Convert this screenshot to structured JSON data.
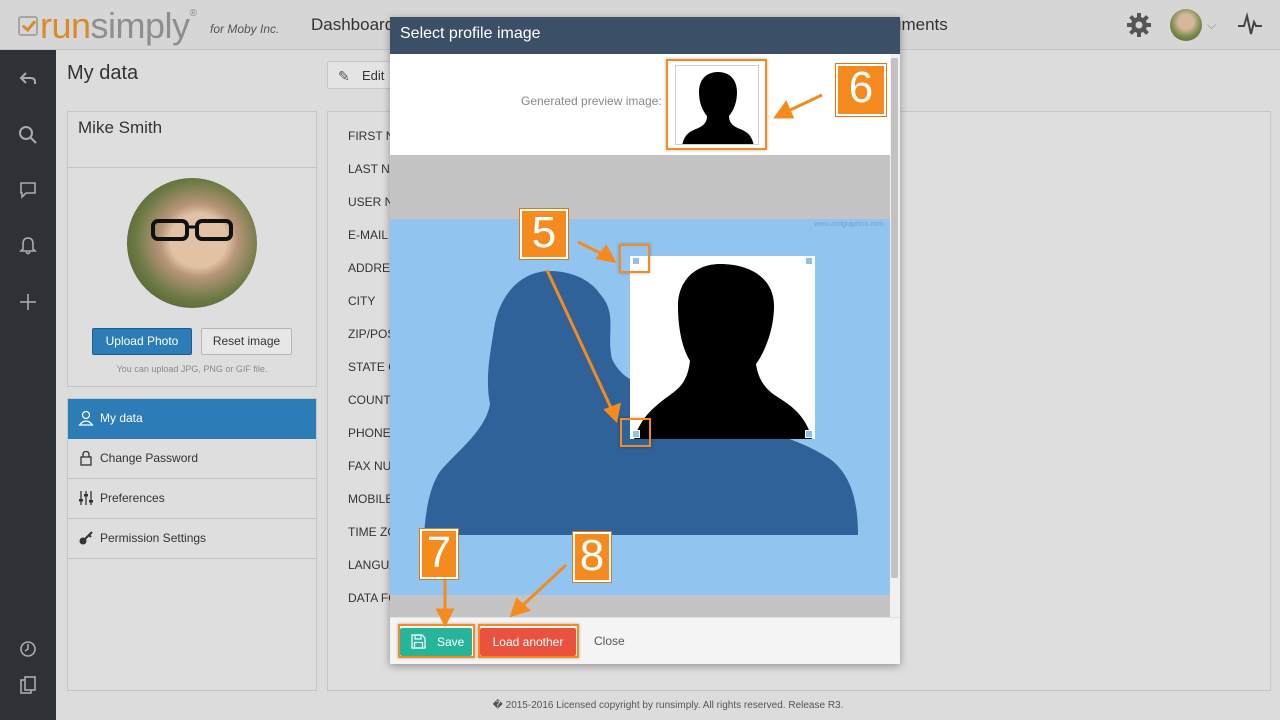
{
  "app": {
    "logo_run": "run",
    "logo_simply": "simply",
    "logo_reg": "®",
    "company": "for Moby Inc.",
    "nav_dashboard": "Dashboard",
    "nav_documents": "uments"
  },
  "page": {
    "title": "My data",
    "edit_label": "Edit"
  },
  "profile": {
    "name": "Mike Smith",
    "upload_label": "Upload Photo",
    "reset_label": "Reset image",
    "hint": "You can upload JPG, PNG or GIF file."
  },
  "menu": {
    "items": [
      {
        "label": "My data",
        "icon": "user-icon"
      },
      {
        "label": "Change Password",
        "icon": "lock-icon"
      },
      {
        "label": "Preferences",
        "icon": "sliders-icon"
      },
      {
        "label": "Permission Settings",
        "icon": "key-icon"
      }
    ]
  },
  "form": {
    "labels": [
      "FIRST N",
      "LAST NA",
      "USER N",
      "E-MAIL",
      "ADDRES",
      "CITY",
      "ZIP/POS",
      "STATE O",
      "COUNT",
      "PHONE",
      "FAX NU",
      "MOBILE",
      "TIME ZO",
      "LANGUA",
      "DATA FO"
    ]
  },
  "footer": {
    "text": "� 2015-2016 Licensed copyright by runsimply. All rights reserved. Release R3."
  },
  "modal": {
    "title": "Select profile image",
    "preview_label": "Generated preview image:",
    "watermark": "www.zodgraphics.com",
    "save_label": "Save",
    "load_label": "Load another",
    "close_label": "Close"
  },
  "annotations": {
    "n5": "5",
    "n6": "6",
    "n7": "7",
    "n8": "8",
    "color": "#f58a1f"
  },
  "colors": {
    "accent": "#2b7cb7",
    "modal_header": "#3b5066",
    "save": "#26b49b",
    "load": "#e8523f",
    "crop_bg": "#92c4f0",
    "silhouette_bg": "#2f6298"
  }
}
